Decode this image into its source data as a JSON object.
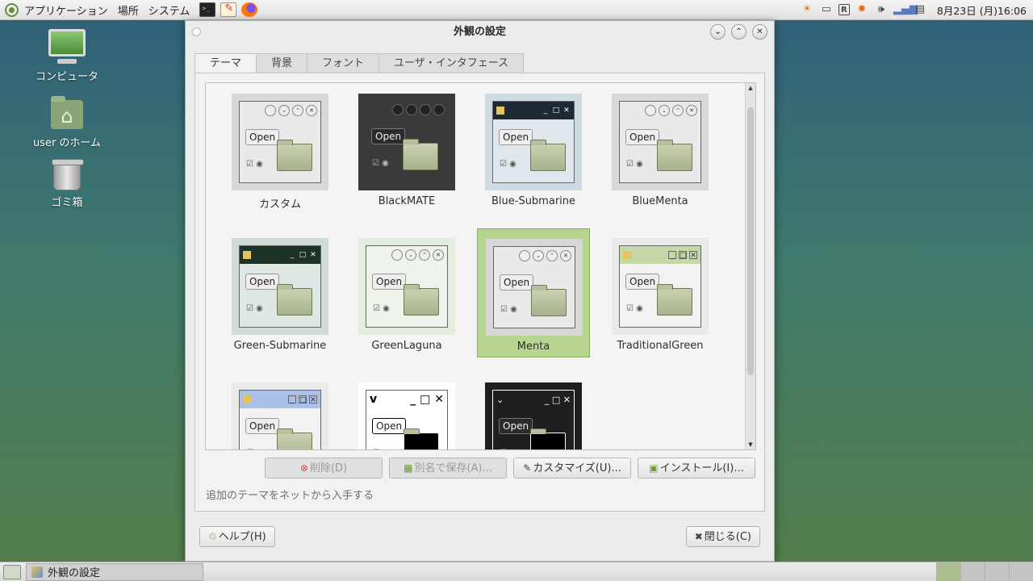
{
  "top_panel": {
    "menus": [
      "アプリケーション",
      "場所",
      "システム"
    ],
    "clock": "8月23日 (月)16:06",
    "tray_icons": [
      "updates-icon",
      "minimize-icon",
      "r-icon",
      "gear-icon",
      "volume-icon",
      "network-icon",
      "screenshot-icon"
    ]
  },
  "desktop": {
    "icons": [
      {
        "label": "コンピュータ",
        "icon": "computer-icon"
      },
      {
        "label": "user のホーム",
        "icon": "home-folder-icon"
      },
      {
        "label": "ゴミ箱",
        "icon": "trash-icon"
      }
    ]
  },
  "window": {
    "title": "外観の設定",
    "tabs": [
      {
        "label": "テーマ",
        "active": true
      },
      {
        "label": "背景",
        "active": false
      },
      {
        "label": "フォント",
        "active": false
      },
      {
        "label": "ユーザ・インタフェース",
        "active": false
      }
    ],
    "themes": [
      {
        "name": "カスタム",
        "style": "custom",
        "selected": false
      },
      {
        "name": "BlackMATE",
        "style": "black",
        "selected": false
      },
      {
        "name": "Blue-Submarine",
        "style": "blue-sub",
        "selected": false
      },
      {
        "name": "BlueMenta",
        "style": "bluementa",
        "selected": false
      },
      {
        "name": "Green-Submarine",
        "style": "green-sub",
        "selected": false
      },
      {
        "name": "GreenLaguna",
        "style": "laguna",
        "selected": false
      },
      {
        "name": "Menta",
        "style": "menta",
        "selected": true
      },
      {
        "name": "TraditionalGreen",
        "style": "traditional",
        "selected": false
      },
      {
        "name": "",
        "style": "traditional-blue",
        "selected": false
      },
      {
        "name": "",
        "style": "high-contrast",
        "selected": false
      },
      {
        "name": "",
        "style": "high-contrast-inverse",
        "selected": false
      }
    ],
    "preview_open_label": "Open",
    "buttons": {
      "delete": "削除(D)",
      "save_as": "別名で保存(A)...",
      "customize": "カスタマイズ(U)...",
      "install": "インストール(I)..."
    },
    "get_more_text": "追加のテーマをネットから入手する",
    "help": "ヘルプ(H)",
    "close": "閉じる(C)"
  },
  "taskbar": {
    "item": "外観の設定"
  }
}
